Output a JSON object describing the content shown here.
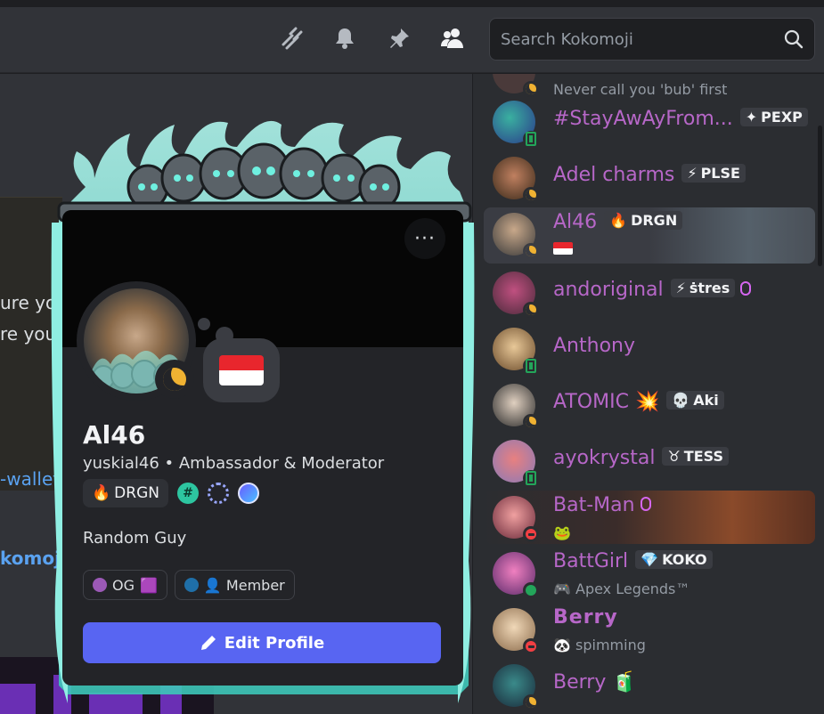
{
  "header": {
    "search_placeholder": "Search Kokomoji",
    "icons": [
      "threads-icon",
      "bell-icon",
      "pin-icon",
      "members-icon",
      "search-icon"
    ]
  },
  "chat": {
    "lines": [
      "ure you",
      "re you'"
    ],
    "link": "-wallet",
    "server_link": "komoji •"
  },
  "members": [
    {
      "name": "",
      "sub": "Never call you 'bub' first",
      "status": "idle"
    },
    {
      "name": "#StayAwAyFrom...",
      "tag": "PEXP",
      "tag_icon": "✦",
      "status": "mobile"
    },
    {
      "name": "Adel charms",
      "tag": "PLSE",
      "tag_icon": "⚡",
      "status": "idle"
    },
    {
      "name": "Al46",
      "tag": "DRGN",
      "tag_icon": "🔥",
      "status": "idle",
      "active": true
    },
    {
      "name": "andoriginal",
      "tag": "ṡtres",
      "tag_icon": "⚡",
      "status": "idle",
      "boost": true
    },
    {
      "name": "Anthony",
      "status": "mobile"
    },
    {
      "name": "ATOMIC",
      "suffix": "💥",
      "tag": "Aki",
      "tag_icon": "💀",
      "status": "idle"
    },
    {
      "name": "ayokrystal",
      "tag": "TESS",
      "tag_icon": "♉",
      "status": "mobile"
    },
    {
      "name": "Bat-Man",
      "sub": "🐸",
      "status": "dnd",
      "boost": true
    },
    {
      "name": "BattGirl",
      "tag": "KOKO",
      "tag_icon": "💎",
      "sub": "🎮 Apex Legends™",
      "status": "online"
    },
    {
      "name": "Berry",
      "sub": "🐼 spimming",
      "status": "dnd"
    },
    {
      "name": "Berry",
      "suffix": "🧃",
      "status": "idle"
    }
  ],
  "profile": {
    "display_name": "Al46",
    "username_line": "yuskial46  •  Ambassador & Moderator",
    "guild_tag": "DRGN",
    "guild_tag_icon": "🔥",
    "badge_hash": "#",
    "about": "Random Guy",
    "roles": [
      {
        "label": "OG",
        "color": "#9b59b6",
        "emoji": "🟪"
      },
      {
        "label": "👤 Member",
        "color": "#1f6fa8"
      }
    ],
    "edit_label": "Edit Profile",
    "more_label": "···"
  },
  "colors": {
    "accent": "#5865f2",
    "member_name": "#b767c8",
    "idle": "#f0b232",
    "online": "#23a55a",
    "dnd": "#f23f43"
  }
}
